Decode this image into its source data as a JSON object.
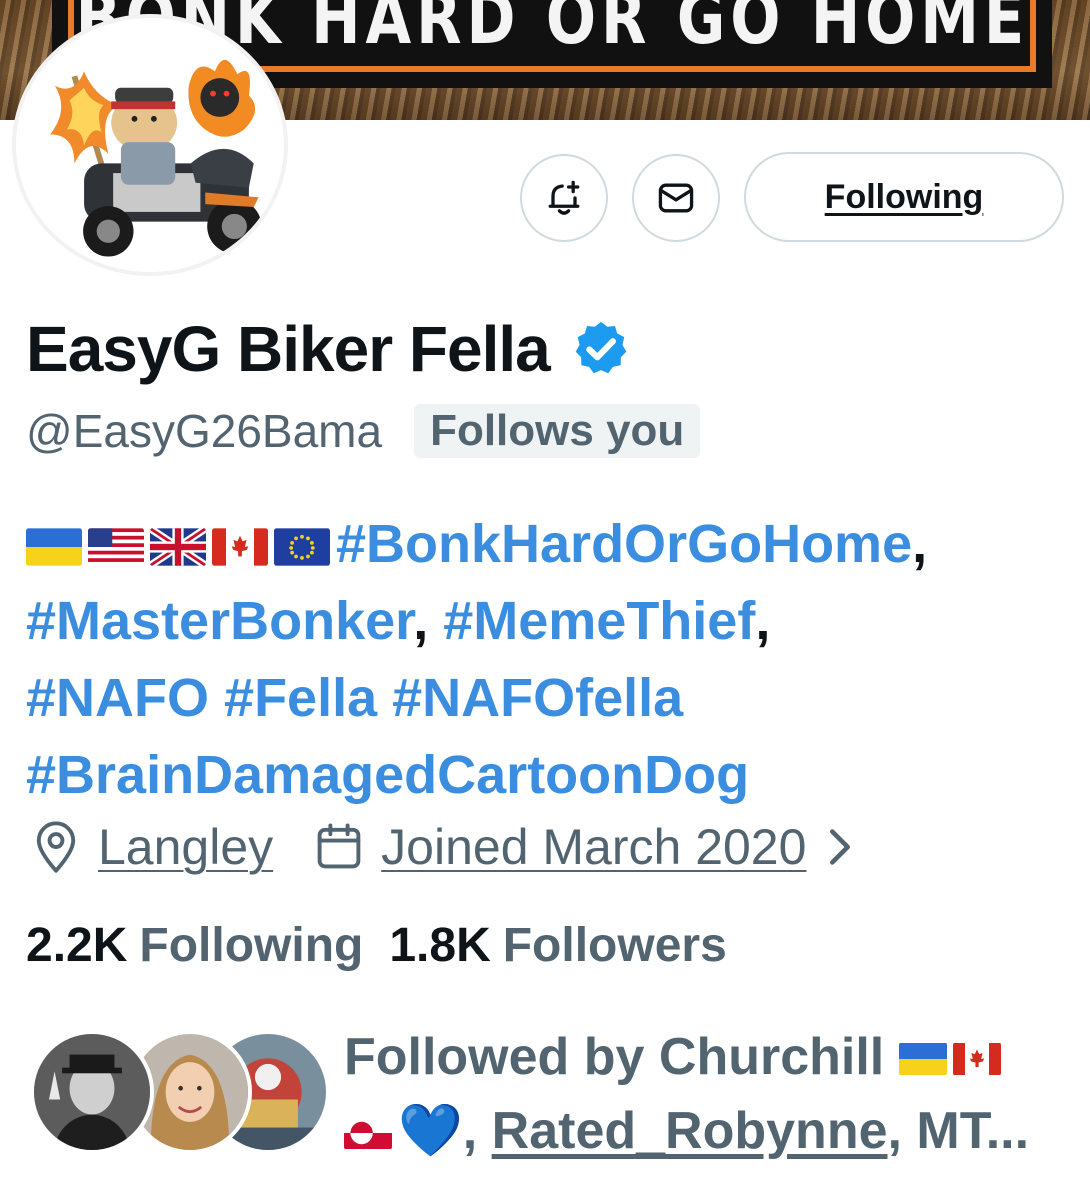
{
  "banner": {
    "text": "BONK HARD OR GO HOME"
  },
  "actions": {
    "notify_icon": "bell-plus-icon",
    "message_icon": "envelope-icon",
    "follow_label": "Following"
  },
  "profile": {
    "display_name": "EasyG Biker Fella",
    "verified": true,
    "handle": "@EasyG26Bama",
    "follows_you": "Follows you"
  },
  "bio": {
    "flags": [
      "ukraine",
      "usa",
      "uk",
      "canada",
      "eu"
    ],
    "tags": [
      "#BonkHardOrGoHome",
      "#MasterBonker",
      "#MemeThief",
      "#NAFO",
      "#Fella",
      "#NAFOfella",
      "#BrainDamagedCartoonDog"
    ],
    "comma": ","
  },
  "meta": {
    "location": "Langley",
    "joined": "Joined March 2020"
  },
  "stats": {
    "following_count": "2.2K",
    "following_label": "Following",
    "followers_count": "1.8K",
    "followers_label": "Followers"
  },
  "followed_by": {
    "prefix": "Followed by Churchill",
    "name2": "Rated_Robynne",
    "suffix": ", MT..."
  },
  "colors": {
    "link": "#3b8ddf",
    "secondary_text": "#536471",
    "primary_text": "#0f1419",
    "verified": "#1d9bf0"
  }
}
